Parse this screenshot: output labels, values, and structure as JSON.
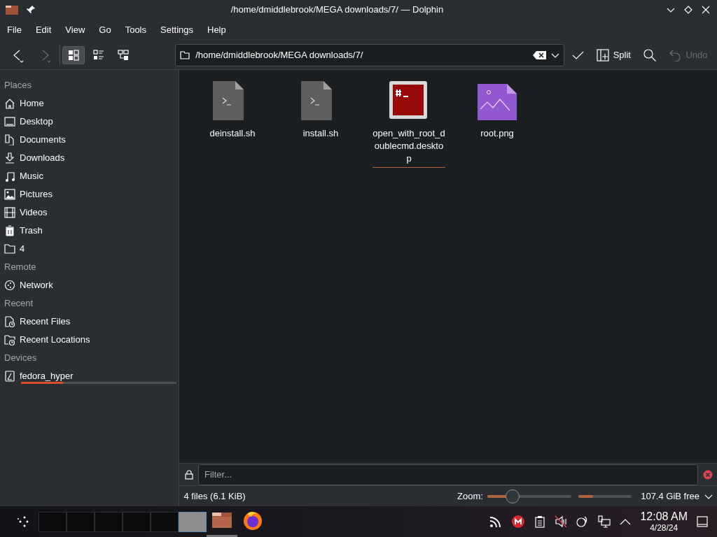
{
  "window": {
    "title": "/home/dmiddlebrook/MEGA downloads/7/ — Dolphin"
  },
  "menu": [
    "File",
    "Edit",
    "View",
    "Go",
    "Tools",
    "Settings",
    "Help"
  ],
  "view_modes": [
    {
      "kind": "icons",
      "selected": true
    },
    {
      "kind": "compact",
      "selected": false
    },
    {
      "kind": "details",
      "selected": false
    }
  ],
  "location": {
    "value": "/home/dmiddlebrook/MEGA downloads/7/"
  },
  "toolbar": {
    "split": "Split",
    "undo": {
      "label": "Undo",
      "disabled": true
    }
  },
  "sidebar": [
    {
      "heading": "Places",
      "items": [
        {
          "label": "Home"
        },
        {
          "label": "Desktop"
        },
        {
          "label": "Documents"
        },
        {
          "label": "Downloads"
        },
        {
          "label": "Music"
        },
        {
          "label": "Pictures"
        },
        {
          "label": "Videos"
        },
        {
          "label": "Trash"
        },
        {
          "label": "4"
        }
      ]
    },
    {
      "heading": "Remote",
      "items": [
        {
          "label": "Network"
        }
      ]
    },
    {
      "heading": "Recent",
      "items": [
        {
          "label": "Recent Files"
        },
        {
          "label": "Recent Locations"
        }
      ]
    },
    {
      "heading": "Devices",
      "items": [
        {
          "label": "fedora_hyper",
          "level": 0.27
        }
      ]
    }
  ],
  "files": [
    {
      "name": "deinstall.sh",
      "kind": "script",
      "hovered": false
    },
    {
      "name": "install.sh",
      "kind": "script",
      "hovered": false
    },
    {
      "name": "open_with_root_doublecmd.desktop",
      "kind": "desktop",
      "hovered": true
    },
    {
      "name": "root.png",
      "kind": "image",
      "hovered": false
    }
  ],
  "filter": {
    "placeholder": "Filter..."
  },
  "status_bar": {
    "summary": "4 files (6.1 KiB)",
    "zoom_label": "Zoom:",
    "zoom": {
      "level": 0.3
    },
    "space": {
      "level": 0.27
    },
    "free": "107.4 GiB free"
  },
  "taskbar": {
    "desktops": [
      {
        "selected": false
      },
      {
        "selected": false
      },
      {
        "selected": false
      },
      {
        "selected": false
      },
      {
        "selected": false
      },
      {
        "selected": true
      }
    ],
    "tasks": [
      {
        "kind": "files",
        "active": true
      },
      {
        "kind": "browser",
        "active": false
      }
    ],
    "time": "12:08 AM",
    "date": "4/28/24"
  }
}
